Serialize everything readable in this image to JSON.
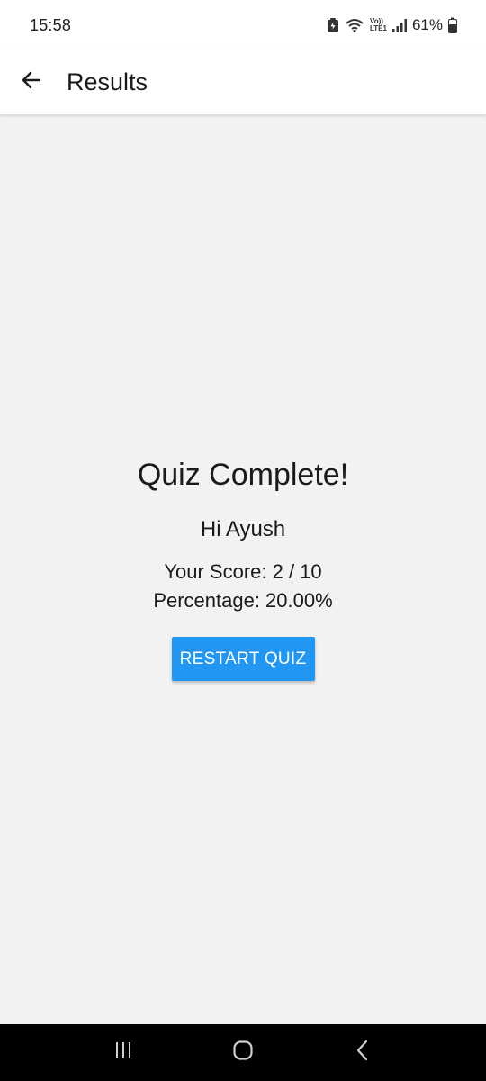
{
  "status_bar": {
    "time": "15:58",
    "volte_top": "Vo))",
    "volte_bottom": "LTE1",
    "battery": "61%"
  },
  "app_bar": {
    "title": "Results",
    "back_icon": "arrow-left-icon"
  },
  "result": {
    "title": "Quiz Complete!",
    "greeting": "Hi Ayush",
    "score": "Your Score: 2 / 10",
    "percentage": "Percentage: 20.00%",
    "restart_label": "RESTART QUIZ"
  },
  "nav_bar": {
    "icons": [
      "recent-apps-icon",
      "home-icon",
      "back-icon"
    ]
  },
  "colors": {
    "accent": "#2196f3",
    "background": "#f2f2f2",
    "app_bar": "#ffffff",
    "nav_bar": "#000000"
  }
}
